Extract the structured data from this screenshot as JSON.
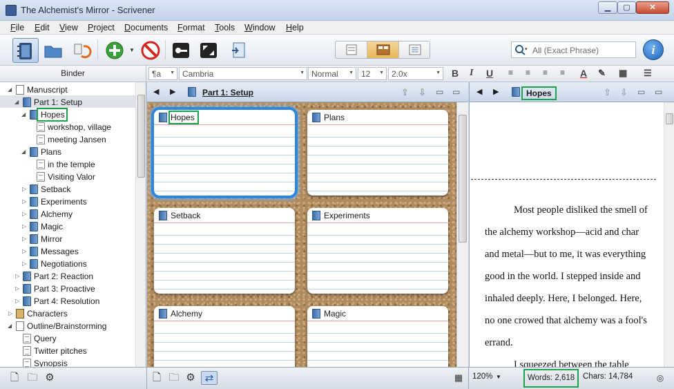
{
  "window": {
    "title": "The Alchemist's Mirror - Scrivener"
  },
  "menu": [
    "File",
    "Edit",
    "View",
    "Project",
    "Documents",
    "Format",
    "Tools",
    "Window",
    "Help"
  ],
  "toolbar": {
    "search_placeholder": "All (Exact Phrase)",
    "info_label": "i"
  },
  "formatbar": {
    "binder_header": "Binder",
    "style": "¶a",
    "font": "Cambria",
    "weight": "Normal",
    "size": "12",
    "spacing": "2.0x"
  },
  "binder": {
    "items": [
      {
        "label": "Manuscript",
        "icon": "manuscript-icon"
      },
      {
        "label": "Part 1: Setup",
        "icon": "folder-icon"
      },
      {
        "label": "Hopes",
        "icon": "folder-icon"
      },
      {
        "label": "workshop, village",
        "icon": "document-icon"
      },
      {
        "label": "meeting Jansen",
        "icon": "document-icon"
      },
      {
        "label": "Plans",
        "icon": "folder-icon"
      },
      {
        "label": "in the temple",
        "icon": "document-icon"
      },
      {
        "label": "Visiting Valor",
        "icon": "document-icon"
      },
      {
        "label": "Setback",
        "icon": "folder-icon"
      },
      {
        "label": "Experiments",
        "icon": "folder-icon"
      },
      {
        "label": "Alchemy",
        "icon": "folder-icon"
      },
      {
        "label": "Magic",
        "icon": "folder-icon"
      },
      {
        "label": "Mirror",
        "icon": "folder-icon"
      },
      {
        "label": "Messages",
        "icon": "folder-icon"
      },
      {
        "label": "Negotiations",
        "icon": "folder-icon"
      },
      {
        "label": "Part 2: Reaction",
        "icon": "folder-icon"
      },
      {
        "label": "Part 3: Proactive",
        "icon": "folder-icon"
      },
      {
        "label": "Part 4: Resolution",
        "icon": "folder-icon"
      },
      {
        "label": "Characters",
        "icon": "character-icon"
      },
      {
        "label": "Outline/Brainstorming",
        "icon": "manuscript-icon"
      },
      {
        "label": "Query",
        "icon": "document-icon"
      },
      {
        "label": "Twitter pitches",
        "icon": "document-icon"
      },
      {
        "label": "Synopsis",
        "icon": "document-icon"
      }
    ]
  },
  "corkboard": {
    "title": "Part 1: Setup",
    "cards": [
      "Hopes",
      "Plans",
      "Setback",
      "Experiments",
      "Alchemy",
      "Magic"
    ]
  },
  "editor": {
    "title": "Hopes",
    "text": "Most people disliked the smell of the alchemy workshop—acid and char and metal—but to me, it was everything good in the world. I stepped inside and inhaled deeply. Here, I belonged. Here, no one crowed that alchemy was a fool's errand.",
    "text2": "I squeezed between the table"
  },
  "footer": {
    "zoom": "120%",
    "words": "Words: 2,618",
    "chars": "Chars: 14,784"
  },
  "colors": {
    "highlight": "#1aa34a",
    "selection": "#2d87e0"
  }
}
